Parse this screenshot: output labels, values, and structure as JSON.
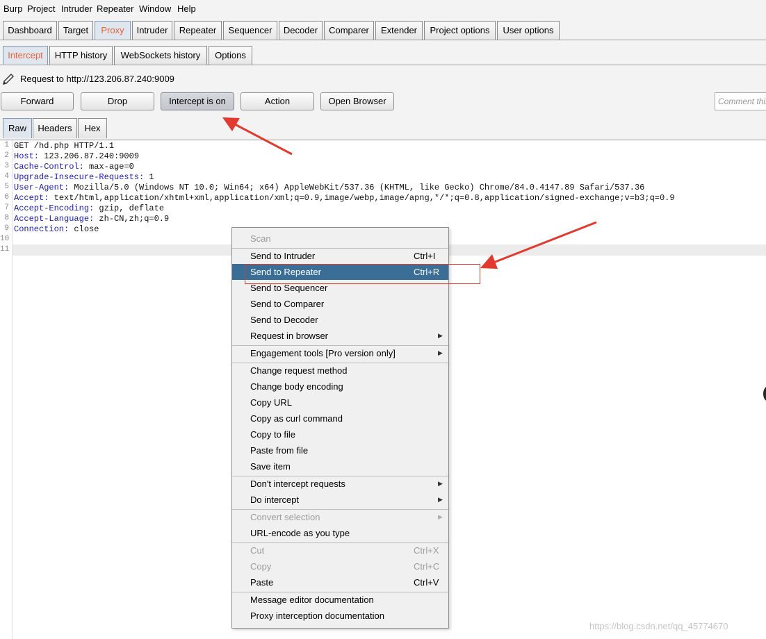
{
  "menubar": [
    "Burp",
    "Project",
    "Intruder",
    "Repeater",
    "Window",
    "Help"
  ],
  "main_tabs": [
    "Dashboard",
    "Target",
    "Proxy",
    "Intruder",
    "Repeater",
    "Sequencer",
    "Decoder",
    "Comparer",
    "Extender",
    "Project options",
    "User options"
  ],
  "main_active": "Proxy",
  "proxy_tabs": [
    "Intercept",
    "HTTP history",
    "WebSockets history",
    "Options"
  ],
  "proxy_active": "Intercept",
  "request_label": "Request to http://123.206.87.240:9009",
  "buttons": {
    "forward": "Forward",
    "drop": "Drop",
    "intercept": "Intercept is on",
    "action": "Action",
    "open_browser": "Open Browser"
  },
  "comment_placeholder": "Comment this item",
  "view_tabs": [
    "Raw",
    "Headers",
    "Hex"
  ],
  "view_active": "Raw",
  "request_lines": [
    {
      "num": "1",
      "name": "",
      "value": "GET /hd.php HTTP/1.1"
    },
    {
      "num": "2",
      "name": "Host:",
      "value": " 123.206.87.240:9009"
    },
    {
      "num": "3",
      "name": "Cache-Control:",
      "value": " max-age=0"
    },
    {
      "num": "4",
      "name": "Upgrade-Insecure-Requests:",
      "value": " 1"
    },
    {
      "num": "5",
      "name": "User-Agent:",
      "value": " Mozilla/5.0 (Windows NT 10.0; Win64; x64) AppleWebKit/537.36 (KHTML, like Gecko) Chrome/84.0.4147.89 Safari/537.36"
    },
    {
      "num": "6",
      "name": "Accept:",
      "value": " text/html,application/xhtml+xml,application/xml;q=0.9,image/webp,image/apng,*/*;q=0.8,application/signed-exchange;v=b3;q=0.9"
    },
    {
      "num": "7",
      "name": "Accept-Encoding:",
      "value": " gzip, deflate"
    },
    {
      "num": "8",
      "name": "Accept-Language:",
      "value": " zh-CN,zh;q=0.9"
    },
    {
      "num": "9",
      "name": "Connection:",
      "value": " close"
    },
    {
      "num": "10",
      "name": "",
      "value": ""
    },
    {
      "num": "11",
      "name": "",
      "value": ""
    }
  ],
  "context_menu": {
    "items": [
      {
        "label": "Scan",
        "shortcut": "",
        "submenu": false,
        "disabled": true,
        "selected": false
      },
      {
        "label": "Send to Intruder",
        "shortcut": "Ctrl+I",
        "submenu": false,
        "disabled": false,
        "selected": false
      },
      {
        "label": "Send to Repeater",
        "shortcut": "Ctrl+R",
        "submenu": false,
        "disabled": false,
        "selected": true
      },
      {
        "label": "Send to Sequencer",
        "shortcut": "",
        "submenu": false,
        "disabled": false,
        "selected": false
      },
      {
        "label": "Send to Comparer",
        "shortcut": "",
        "submenu": false,
        "disabled": false,
        "selected": false
      },
      {
        "label": "Send to Decoder",
        "shortcut": "",
        "submenu": false,
        "disabled": false,
        "selected": false
      },
      {
        "label": "Request in browser",
        "shortcut": "",
        "submenu": true,
        "disabled": false,
        "selected": false
      },
      {
        "label": "Engagement tools [Pro version only]",
        "shortcut": "",
        "submenu": true,
        "disabled": false,
        "selected": false
      },
      {
        "label": "Change request method",
        "shortcut": "",
        "submenu": false,
        "disabled": false,
        "selected": false
      },
      {
        "label": "Change body encoding",
        "shortcut": "",
        "submenu": false,
        "disabled": false,
        "selected": false
      },
      {
        "label": "Copy URL",
        "shortcut": "",
        "submenu": false,
        "disabled": false,
        "selected": false
      },
      {
        "label": "Copy as curl command",
        "shortcut": "",
        "submenu": false,
        "disabled": false,
        "selected": false
      },
      {
        "label": "Copy to file",
        "shortcut": "",
        "submenu": false,
        "disabled": false,
        "selected": false
      },
      {
        "label": "Paste from file",
        "shortcut": "",
        "submenu": false,
        "disabled": false,
        "selected": false
      },
      {
        "label": "Save item",
        "shortcut": "",
        "submenu": false,
        "disabled": false,
        "selected": false
      },
      {
        "label": "Don't intercept requests",
        "shortcut": "",
        "submenu": true,
        "disabled": false,
        "selected": false
      },
      {
        "label": "Do intercept",
        "shortcut": "",
        "submenu": true,
        "disabled": false,
        "selected": false
      },
      {
        "label": "Convert selection",
        "shortcut": "",
        "submenu": true,
        "disabled": true,
        "selected": false
      },
      {
        "label": "URL-encode as you type",
        "shortcut": "",
        "submenu": false,
        "disabled": false,
        "selected": false
      },
      {
        "label": "Cut",
        "shortcut": "Ctrl+X",
        "submenu": false,
        "disabled": true,
        "selected": false
      },
      {
        "label": "Copy",
        "shortcut": "Ctrl+C",
        "submenu": false,
        "disabled": true,
        "selected": false
      },
      {
        "label": "Paste",
        "shortcut": "Ctrl+V",
        "submenu": false,
        "disabled": false,
        "selected": false
      },
      {
        "label": "Message editor documentation",
        "shortcut": "",
        "submenu": false,
        "disabled": false,
        "selected": false
      },
      {
        "label": "Proxy interception documentation",
        "shortcut": "",
        "submenu": false,
        "disabled": false,
        "selected": false
      }
    ]
  },
  "watermark": "https://blog.csdn.net/qq_45774670",
  "colors": {
    "active_tab_text": "#e8613b",
    "menu_selection": "#3a6e97",
    "header_name": "#1b1bb0",
    "annotation_red": "#e23a2f"
  },
  "icons": {
    "edit": "pencil-icon",
    "submenu": "triangle-right-icon"
  }
}
